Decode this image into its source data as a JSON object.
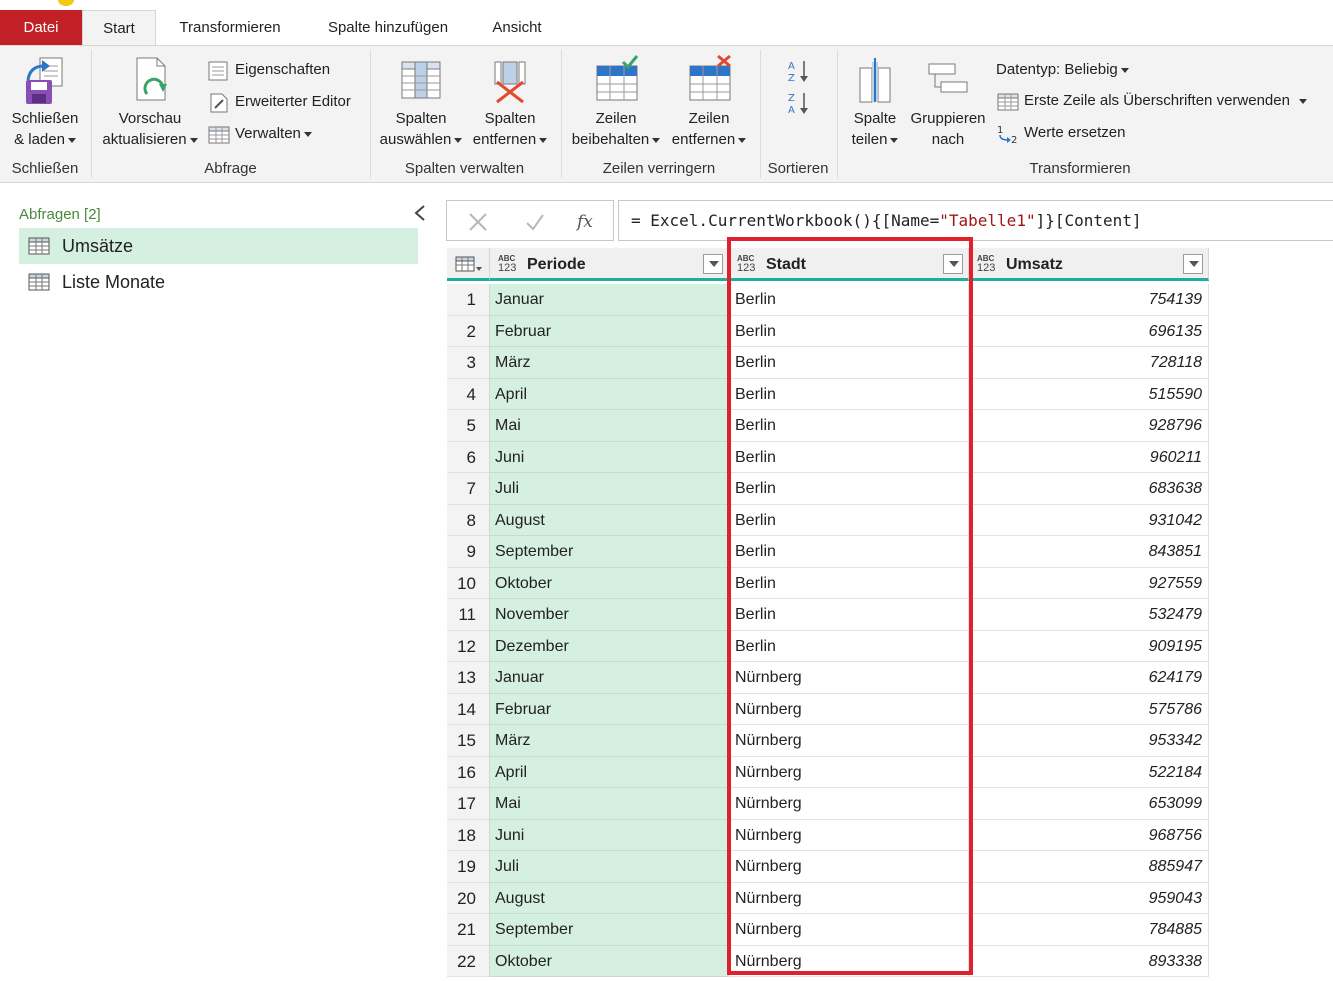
{
  "tabs": [
    {
      "label": "Datei"
    },
    {
      "label": "Start"
    },
    {
      "label": "Transformieren"
    },
    {
      "label": "Spalte hinzufügen"
    },
    {
      "label": "Ansicht"
    }
  ],
  "ribbon": {
    "schliessen": {
      "line1": "Schließen",
      "line2": "& laden",
      "group": "Schließen"
    },
    "abfrage": {
      "vorschau_line1": "Vorschau",
      "vorschau_line2": "aktualisieren",
      "eigenschaften": "Eigenschaften",
      "erweiterter_editor": "Erweiterter Editor",
      "verwalten": "Verwalten",
      "group": "Abfrage"
    },
    "spalten_verwalten": {
      "auswaehlen_line1": "Spalten",
      "auswaehlen_line2": "auswählen",
      "entfernen_line1": "Spalten",
      "entfernen_line2": "entfernen",
      "group": "Spalten verwalten"
    },
    "zeilen_verringern": {
      "beibehalten_line1": "Zeilen",
      "beibehalten_line2": "beibehalten",
      "entfernen_line1": "Zeilen",
      "entfernen_line2": "entfernen",
      "group": "Zeilen verringern"
    },
    "sortieren": {
      "group": "Sortieren"
    },
    "transformieren": {
      "teilen_line1": "Spalte",
      "teilen_line2": "teilen",
      "gruppieren_line1": "Gruppieren",
      "gruppieren_line2": "nach",
      "datentyp": "Datentyp: Beliebig",
      "erste_zeile": "Erste Zeile als Überschriften verwenden",
      "werte_ersetzen": "Werte ersetzen",
      "group": "Transformieren"
    }
  },
  "queries": {
    "title": "Abfragen [2]",
    "items": [
      {
        "label": "Umsätze",
        "selected": true
      },
      {
        "label": "Liste Monate",
        "selected": false
      }
    ]
  },
  "formula": {
    "prefix": "= Excel.CurrentWorkbook(){[Name=",
    "string": "\"Tabelle1\"",
    "suffix": "]}[Content]"
  },
  "grid": {
    "columns": [
      {
        "type_top": "ABC",
        "type_bottom": "123",
        "name": "Periode"
      },
      {
        "type_top": "ABC",
        "type_bottom": "123",
        "name": "Stadt"
      },
      {
        "type_top": "ABC",
        "type_bottom": "123",
        "name": "Umsatz"
      }
    ],
    "rows": [
      {
        "idx": "1",
        "periode": "Januar",
        "stadt": "Berlin",
        "umsatz": "754139"
      },
      {
        "idx": "2",
        "periode": "Februar",
        "stadt": "Berlin",
        "umsatz": "696135"
      },
      {
        "idx": "3",
        "periode": "März",
        "stadt": "Berlin",
        "umsatz": "728118"
      },
      {
        "idx": "4",
        "periode": "April",
        "stadt": "Berlin",
        "umsatz": "515590"
      },
      {
        "idx": "5",
        "periode": "Mai",
        "stadt": "Berlin",
        "umsatz": "928796"
      },
      {
        "idx": "6",
        "periode": "Juni",
        "stadt": "Berlin",
        "umsatz": "960211"
      },
      {
        "idx": "7",
        "periode": "Juli",
        "stadt": "Berlin",
        "umsatz": "683638"
      },
      {
        "idx": "8",
        "periode": "August",
        "stadt": "Berlin",
        "umsatz": "931042"
      },
      {
        "idx": "9",
        "periode": "September",
        "stadt": "Berlin",
        "umsatz": "843851"
      },
      {
        "idx": "10",
        "periode": "Oktober",
        "stadt": "Berlin",
        "umsatz": "927559"
      },
      {
        "idx": "11",
        "periode": "November",
        "stadt": "Berlin",
        "umsatz": "532479"
      },
      {
        "idx": "12",
        "periode": "Dezember",
        "stadt": "Berlin",
        "umsatz": "909195"
      },
      {
        "idx": "13",
        "periode": "Januar",
        "stadt": "Nürnberg",
        "umsatz": "624179"
      },
      {
        "idx": "14",
        "periode": "Februar",
        "stadt": "Nürnberg",
        "umsatz": "575786"
      },
      {
        "idx": "15",
        "periode": "März",
        "stadt": "Nürnberg",
        "umsatz": "953342"
      },
      {
        "idx": "16",
        "periode": "April",
        "stadt": "Nürnberg",
        "umsatz": "522184"
      },
      {
        "idx": "17",
        "periode": "Mai",
        "stadt": "Nürnberg",
        "umsatz": "653099"
      },
      {
        "idx": "18",
        "periode": "Juni",
        "stadt": "Nürnberg",
        "umsatz": "968756"
      },
      {
        "idx": "19",
        "periode": "Juli",
        "stadt": "Nürnberg",
        "umsatz": "885947"
      },
      {
        "idx": "20",
        "periode": "August",
        "stadt": "Nürnberg",
        "umsatz": "959043"
      },
      {
        "idx": "21",
        "periode": "September",
        "stadt": "Nürnberg",
        "umsatz": "784885"
      },
      {
        "idx": "22",
        "periode": "Oktober",
        "stadt": "Nürnberg",
        "umsatz": "893338"
      }
    ]
  },
  "colors": {
    "datei_tab": "#c21f26",
    "header_underline": "#1fae9b",
    "selected_column": "#d5efe0",
    "highlight_box": "#e0202a"
  }
}
